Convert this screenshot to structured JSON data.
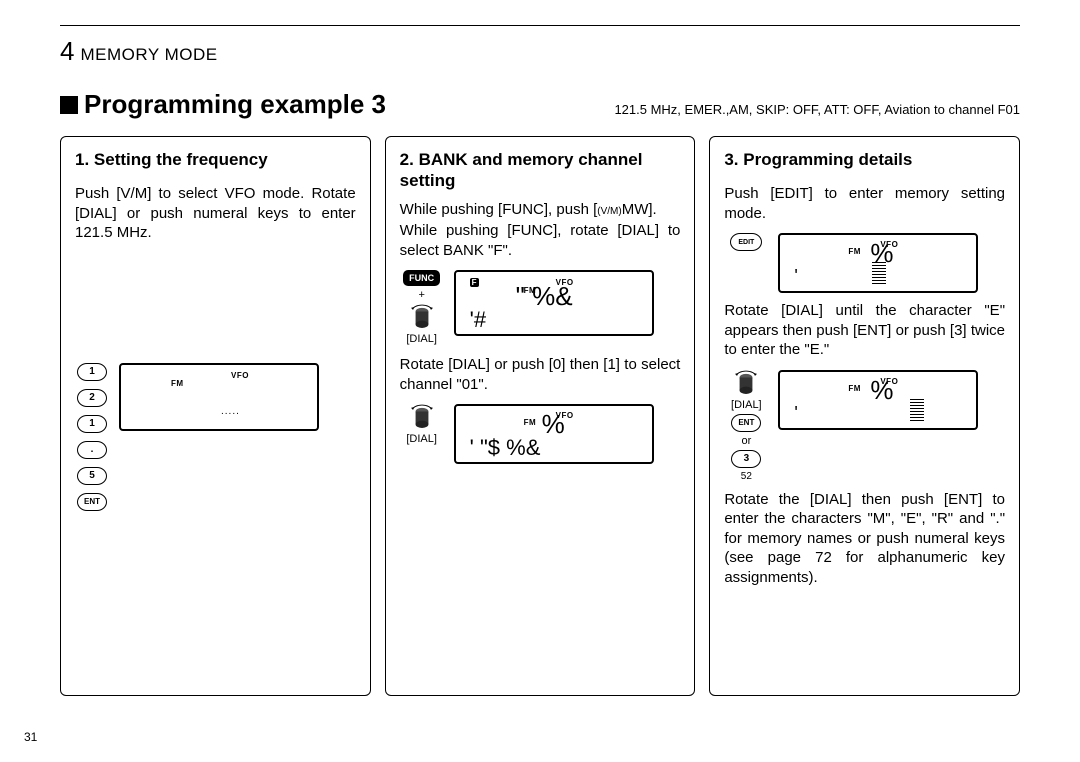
{
  "chapter": {
    "num": "4",
    "label": "MEMORY MODE"
  },
  "title": "Programming example 3",
  "note": "121.5 MHz, EMER.,AM, SKIP: OFF, ATT: OFF, Aviation to channel F01",
  "page_number": "31",
  "col1": {
    "heading": "1. Setting the frequency",
    "text": "Push [V/M] to select VFO mode. Rotate [DIAL] or push numeral keys to enter 121.5 MHz.",
    "keys": [
      "1",
      "2",
      "1",
      ".",
      "5",
      "ENT"
    ],
    "lcd": {
      "fm": "FM",
      "vfo": "VFO"
    }
  },
  "col2": {
    "heading": "2. BANK and memory channel setting",
    "text1": "While pushing [FUNC], push [",
    "text1b": "MW].",
    "text1_sub": "(V/M)",
    "text2": "While pushing [FUNC], rotate [DIAL] to select BANK \"F\".",
    "side1": {
      "func": "FUNC",
      "plus": "+",
      "dial": "[DIAL]"
    },
    "lcd1": {
      "f": "F",
      "fm": "FM",
      "vfo": "VFO",
      "big1": "\" %&",
      "big2": "'#"
    },
    "text3": "Rotate [DIAL] or push [0] then [1] to select channel \"01\".",
    "side2": {
      "dial": "[DIAL]"
    },
    "lcd2": {
      "fm": "FM",
      "vfo": "VFO",
      "big1": "%",
      "big2": "'    \"$ %&"
    }
  },
  "col3": {
    "heading": "3. Programming details",
    "text1": "Push [EDIT] to enter memory setting mode.",
    "side1_key": "EDIT",
    "lcd1": {
      "fm": "FM",
      "vfo": "VFO",
      "big1": "%",
      "big2": "'"
    },
    "text2": "Rotate [DIAL] until the character \"E\" appears then push [ENT] or push [3] twice to enter the \"E.\"",
    "side2": {
      "dial": "[DIAL]",
      "ent": "ENT",
      "or": "or",
      "three": "3",
      "five2": "52"
    },
    "lcd2": {
      "fm": "FM",
      "vfo": "VFO",
      "big1": "%",
      "big2": "'"
    },
    "text3": "Rotate the [DIAL] then push [ENT] to enter the characters \"M\", \"E\", \"R\" and \".\" for memory names or push numeral keys (see page 72 for alphanumeric key assignments)."
  }
}
